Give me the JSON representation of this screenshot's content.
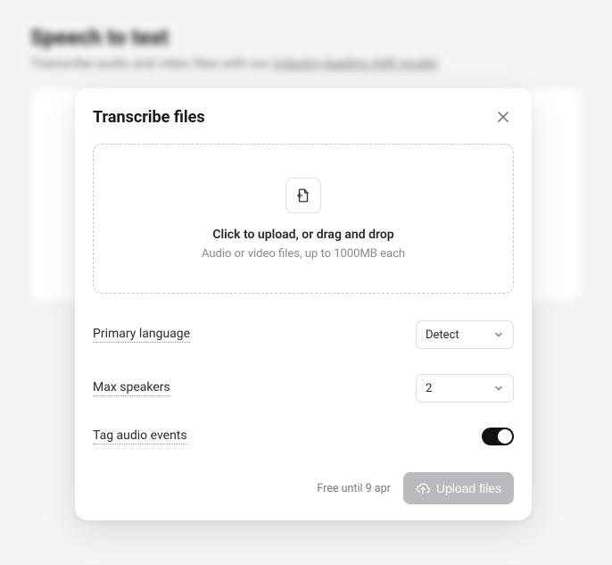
{
  "background": {
    "title": "Speech to text",
    "subtitle_pre": "Transcribe audio and video files with our ",
    "subtitle_link": "industry-leading ASR model",
    "subtitle_post": "."
  },
  "modal": {
    "title": "Transcribe files",
    "dropzone": {
      "primary": "Click to upload, or drag and drop",
      "secondary": "Audio or video files, up to 1000MB each"
    },
    "settings": {
      "primary_language": {
        "label": "Primary language",
        "value": "Detect"
      },
      "max_speakers": {
        "label": "Max speakers",
        "value": "2"
      },
      "tag_audio_events": {
        "label": "Tag audio events",
        "value": true
      }
    },
    "footer": {
      "note": "Free until 9 apr",
      "upload_label": "Upload files"
    }
  }
}
